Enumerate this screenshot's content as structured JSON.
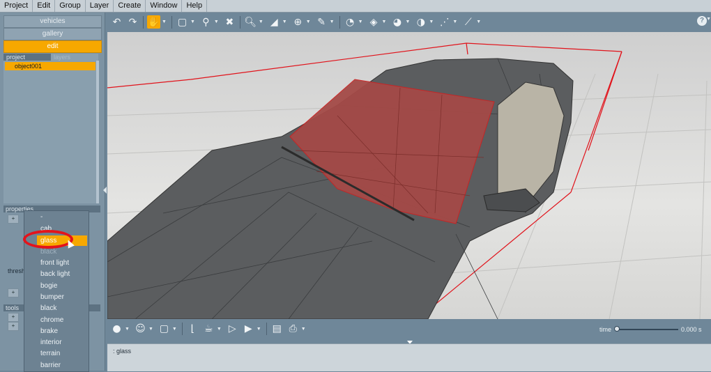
{
  "menubar": {
    "items": [
      "Project",
      "Edit",
      "Group",
      "Layer",
      "Create",
      "Window",
      "Help"
    ]
  },
  "left_panel": {
    "modes": [
      {
        "label": "vehicles",
        "active": false
      },
      {
        "label": "gallery",
        "active": false
      },
      {
        "label": "edit",
        "active": true
      }
    ],
    "tabs": [
      {
        "label": "project",
        "active": true
      },
      {
        "label": "layers",
        "active": false
      }
    ],
    "objects": [
      {
        "label": "object001",
        "selected": true
      }
    ],
    "properties_header": "properties",
    "threshold_label": "thresh",
    "tools_header": "tools",
    "small_buttons": [
      "+",
      "+",
      "+",
      "+"
    ]
  },
  "material_dropdown": {
    "items": [
      "-",
      "cab",
      "glass",
      "black",
      "front light",
      "back light",
      "bogie",
      "bumper",
      "black",
      "chrome",
      "brake",
      "interior",
      "terrain",
      "barrier"
    ],
    "selected_index": 2
  },
  "toolbar": {
    "icons": [
      "undo-icon",
      "redo-icon",
      "pan-hand-icon",
      "select-box-icon",
      "transform-icon",
      "delete-icon",
      "zoom-icon",
      "paint-icon",
      "move-icon",
      "measure-icon",
      "gauge-icon",
      "cube-icon",
      "gauge-alt-icon",
      "gauge-dial-icon",
      "vertices-icon",
      "tube-icon"
    ],
    "active_icon": "pan-hand-icon",
    "help_label": "?"
  },
  "timeline": {
    "icons": [
      "sphere-icon",
      "head-icon",
      "frame-icon",
      "curve-icon",
      "teapot-icon",
      "play-icon",
      "sequence-icon",
      "document-icon",
      "printer-icon"
    ],
    "time_label": "time",
    "time_value": "0.000 s",
    "time_fraction": 0.0
  },
  "console": {
    "text": ": glass"
  },
  "colors": {
    "accent": "#f7a800",
    "selection_highlight": "#e3141c",
    "panel": "#7d93a3"
  }
}
